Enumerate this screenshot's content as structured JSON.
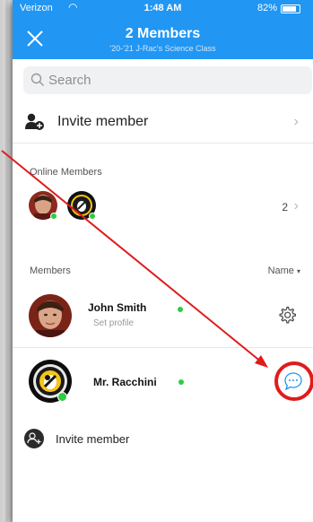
{
  "status_bar": {
    "carrier": "Verizon",
    "time": "1:48 AM",
    "battery": "82%"
  },
  "header": {
    "title": "2 Members",
    "subtitle": "'20-'21 J-Rac's Science Class",
    "background_color": "#2196f3"
  },
  "search": {
    "placeholder": "Search"
  },
  "invite_top": {
    "label": "Invite member"
  },
  "online_members": {
    "label": "Online Members",
    "count": "2"
  },
  "members": {
    "label": "Members",
    "sort_label": "Name",
    "list": [
      {
        "name": "John Smith",
        "subtitle": "Set profile",
        "online": true,
        "action_icon": "gear-icon"
      },
      {
        "name": "Mr. Racchini",
        "subtitle": "",
        "online": true,
        "action_icon": "chat-bubble-icon"
      }
    ]
  },
  "invite_bottom": {
    "label": "Invite member"
  },
  "annotation": {
    "arrow_color": "#e01b1b",
    "circle_color": "#e01b1b"
  }
}
